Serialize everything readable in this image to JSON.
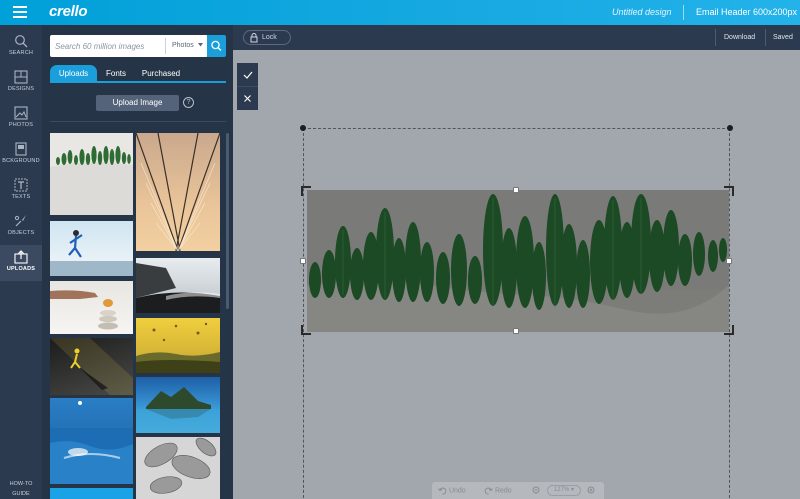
{
  "app": {
    "logo": "crello",
    "doc_title": "Untitled design",
    "doc_size": "Email Header 600x200px"
  },
  "leftnav": {
    "items": [
      {
        "label": "SEARCH",
        "icon": "search-icon"
      },
      {
        "label": "DESIGNS",
        "icon": "designs-icon"
      },
      {
        "label": "PHOTOS",
        "icon": "photos-icon"
      },
      {
        "label": "BCKGROUND",
        "icon": "background-icon"
      },
      {
        "label": "TEXTS",
        "icon": "texts-icon"
      },
      {
        "label": "OBJECTS",
        "icon": "objects-icon"
      },
      {
        "label": "UPLOADS",
        "icon": "uploads-icon"
      }
    ],
    "active": "UPLOADS",
    "howto_line1": "HOW-TO",
    "howto_line2": "GUIDE"
  },
  "panel": {
    "search_placeholder": "Search 60 million images",
    "search_filter": "Photos",
    "tabs": [
      {
        "label": "Uploads",
        "active": true
      },
      {
        "label": "Fonts",
        "active": false
      },
      {
        "label": "Purchased",
        "active": false
      }
    ],
    "upload_button": "Upload Image",
    "help_glyph": "?",
    "thumbnails": [
      "leaf forest",
      "bridge cables",
      "runner on track",
      "black sand beach",
      "hand stacking stones",
      "hot air balloons",
      "runner shadow",
      "island lake",
      "jumping into sea",
      "gray leaves",
      "blue"
    ]
  },
  "toolbar": {
    "lock_label": "Lock",
    "download_label": "Download",
    "saved_label": "Saved"
  },
  "canvas": {
    "confirm_glyph": "✓",
    "cancel_glyph": "✕"
  },
  "bottom_bar": {
    "undo_label": "Undo",
    "redo_label": "Redo",
    "zoom_value": "127%"
  },
  "colors": {
    "accent": "#1a9fdb",
    "nav_bg": "#2c3a4f",
    "panel_bg": "#263448",
    "canvas_bg": "#a2a6ad"
  }
}
